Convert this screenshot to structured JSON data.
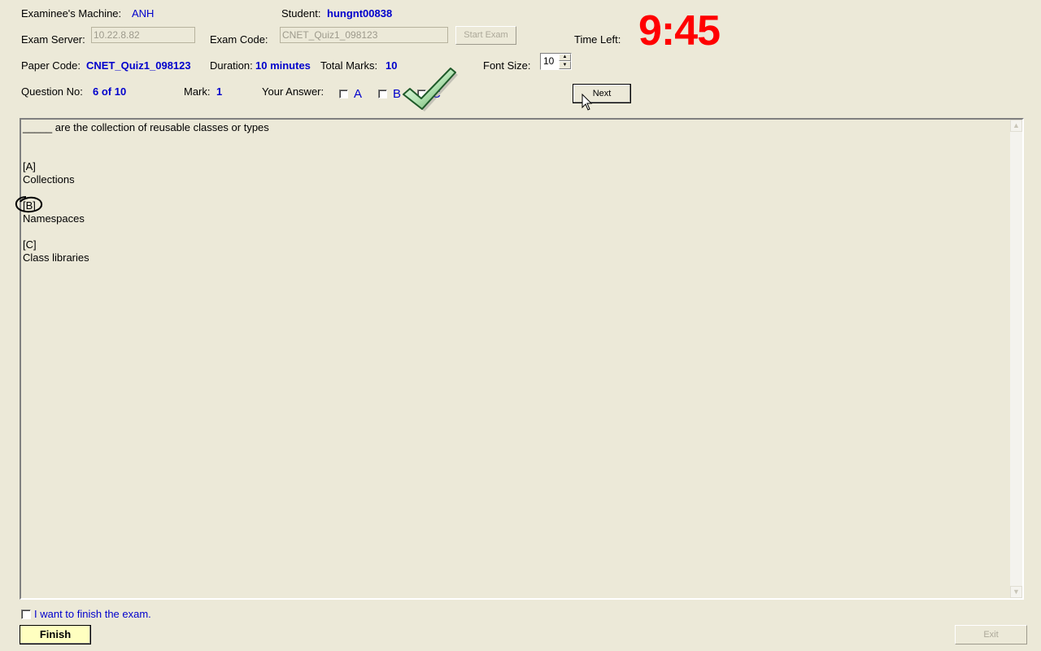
{
  "header": {
    "machine_label": "Examinee's Machine:",
    "machine_value": "ANH",
    "student_label": "Student:",
    "student_value": "hungnt00838",
    "server_label": "Exam Server:",
    "server_value": "10.22.8.82",
    "exam_code_label": "Exam Code:",
    "exam_code_value": "CNET_Quiz1_098123",
    "start_exam_label": "Start Exam",
    "time_left_label": "Time Left:",
    "time_left_value": "9:45",
    "paper_code_label": "Paper Code:",
    "paper_code_value": "CNET_Quiz1_098123",
    "duration_label": "Duration:",
    "duration_value": "10 minutes",
    "total_marks_label": "Total Marks:",
    "total_marks_value": "10",
    "font_size_label": "Font Size:",
    "font_size_value": "10",
    "question_no_label": "Question No:",
    "question_no_value": "6 of 10",
    "mark_label": "Mark:",
    "mark_value": "1",
    "your_answer_label": "Your Answer:",
    "next_label": "Next"
  },
  "answer_options": [
    "A",
    "B",
    "C"
  ],
  "question": {
    "text": "_____ are the collection of reusable classes or types",
    "options": [
      {
        "key": "[A]",
        "text": "Collections"
      },
      {
        "key": "[B]",
        "text": "Namespaces"
      },
      {
        "key": "[C]",
        "text": "Class libraries"
      }
    ]
  },
  "footer": {
    "finish_checkbox_label": "I want to finish the exam.",
    "finish_label": "Finish",
    "exit_label": "Exit"
  },
  "colors": {
    "background": "#ece9d8",
    "value_blue": "#0000cc",
    "timer_red": "#ff0000",
    "finish_yellow": "#ffffc0"
  }
}
